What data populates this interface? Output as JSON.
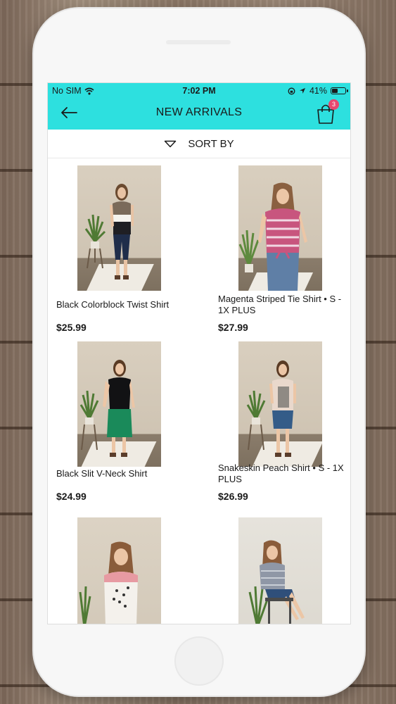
{
  "status": {
    "carrier": "No SIM",
    "time": "7:02 PM",
    "battery": "41%"
  },
  "header": {
    "title": "NEW ARRIVALS",
    "cart_count": "3"
  },
  "sort": {
    "label": "SORT BY"
  },
  "products": [
    {
      "name": "Black Colorblock Twist Shirt",
      "price": "$25.99"
    },
    {
      "name": "Magenta Striped Tie Shirt • S - 1X PLUS",
      "price": "$27.99"
    },
    {
      "name": "Black Slit V-Neck Shirt",
      "price": "$24.99"
    },
    {
      "name": "Snakeskin Peach Shirt • S - 1X PLUS",
      "price": "$26.99"
    },
    {
      "name": "",
      "price": ""
    },
    {
      "name": "",
      "price": ""
    }
  ],
  "colors": {
    "header_bg": "#2de0df",
    "badge": "#e6476f"
  }
}
